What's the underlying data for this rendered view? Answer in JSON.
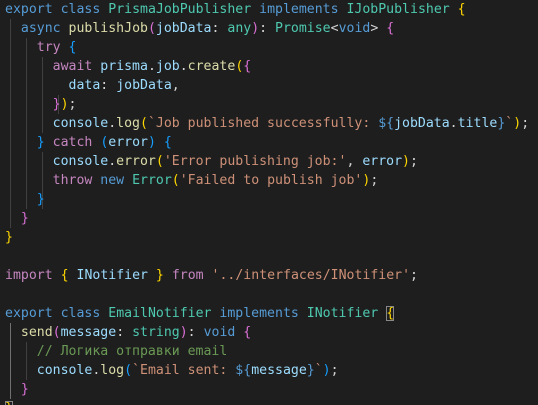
{
  "editor": {
    "theme": {
      "background": "#1e1e1e",
      "keyword": "#569cd6",
      "control": "#c586c0",
      "type": "#4ec9b0",
      "function": "#dcdcaa",
      "variable": "#9cdcfe",
      "string": "#ce9178",
      "comment": "#6a9955",
      "bracket_1": "#ffd700",
      "bracket_2": "#da70d6",
      "bracket_3": "#179fff"
    },
    "lines": [
      [
        {
          "c": "k",
          "t": "export"
        },
        {
          "c": "p",
          "t": " "
        },
        {
          "c": "k",
          "t": "class"
        },
        {
          "c": "p",
          "t": " "
        },
        {
          "c": "ty",
          "t": "PrismaJobPublisher"
        },
        {
          "c": "p",
          "t": " "
        },
        {
          "c": "k",
          "t": "implements"
        },
        {
          "c": "p",
          "t": " "
        },
        {
          "c": "ty",
          "t": "IJobPublisher"
        },
        {
          "c": "p",
          "t": " "
        },
        {
          "c": "b1",
          "t": "{"
        }
      ],
      [
        {
          "c": "p",
          "t": "  "
        },
        {
          "c": "k",
          "t": "async"
        },
        {
          "c": "p",
          "t": " "
        },
        {
          "c": "fn",
          "t": "publishJob"
        },
        {
          "c": "b2",
          "t": "("
        },
        {
          "c": "vr",
          "t": "jobData"
        },
        {
          "c": "p",
          "t": ": "
        },
        {
          "c": "ty",
          "t": "any"
        },
        {
          "c": "b2",
          "t": ")"
        },
        {
          "c": "p",
          "t": ": "
        },
        {
          "c": "ty",
          "t": "Promise"
        },
        {
          "c": "p",
          "t": "<"
        },
        {
          "c": "k",
          "t": "void"
        },
        {
          "c": "p",
          "t": "> "
        },
        {
          "c": "b2",
          "t": "{"
        }
      ],
      [
        {
          "c": "p",
          "t": "    "
        },
        {
          "c": "ctl",
          "t": "try"
        },
        {
          "c": "p",
          "t": " "
        },
        {
          "c": "b3",
          "t": "{"
        }
      ],
      [
        {
          "c": "p",
          "t": "      "
        },
        {
          "c": "ctl",
          "t": "await"
        },
        {
          "c": "p",
          "t": " "
        },
        {
          "c": "vr",
          "t": "prisma"
        },
        {
          "c": "p",
          "t": "."
        },
        {
          "c": "vr",
          "t": "job"
        },
        {
          "c": "p",
          "t": "."
        },
        {
          "c": "fn",
          "t": "create"
        },
        {
          "c": "b1",
          "t": "("
        },
        {
          "c": "b2",
          "t": "{"
        }
      ],
      [
        {
          "c": "p",
          "t": "        "
        },
        {
          "c": "vr",
          "t": "data"
        },
        {
          "c": "p",
          "t": ": "
        },
        {
          "c": "vr",
          "t": "jobData"
        },
        {
          "c": "p",
          "t": ","
        }
      ],
      [
        {
          "c": "p",
          "t": "      "
        },
        {
          "c": "b2",
          "t": "}"
        },
        {
          "c": "b1",
          "t": ")"
        },
        {
          "c": "p",
          "t": ";"
        }
      ],
      [
        {
          "c": "p",
          "t": "      "
        },
        {
          "c": "vr",
          "t": "console"
        },
        {
          "c": "p",
          "t": "."
        },
        {
          "c": "fn",
          "t": "log"
        },
        {
          "c": "b1",
          "t": "("
        },
        {
          "c": "st",
          "t": "`Job published successfully: "
        },
        {
          "c": "k",
          "t": "${"
        },
        {
          "c": "vr",
          "t": "jobData"
        },
        {
          "c": "p",
          "t": "."
        },
        {
          "c": "vr",
          "t": "title"
        },
        {
          "c": "k",
          "t": "}"
        },
        {
          "c": "st",
          "t": "`"
        },
        {
          "c": "b1",
          "t": ")"
        },
        {
          "c": "p",
          "t": ";"
        }
      ],
      [
        {
          "c": "p",
          "t": "    "
        },
        {
          "c": "b3",
          "t": "}"
        },
        {
          "c": "p",
          "t": " "
        },
        {
          "c": "ctl",
          "t": "catch"
        },
        {
          "c": "p",
          "t": " "
        },
        {
          "c": "b3",
          "t": "("
        },
        {
          "c": "vr",
          "t": "error"
        },
        {
          "c": "b3",
          "t": ")"
        },
        {
          "c": "p",
          "t": " "
        },
        {
          "c": "b3",
          "t": "{"
        }
      ],
      [
        {
          "c": "p",
          "t": "      "
        },
        {
          "c": "vr",
          "t": "console"
        },
        {
          "c": "p",
          "t": "."
        },
        {
          "c": "fn",
          "t": "error"
        },
        {
          "c": "b1",
          "t": "("
        },
        {
          "c": "st",
          "t": "'Error publishing job:'"
        },
        {
          "c": "p",
          "t": ", "
        },
        {
          "c": "vr",
          "t": "error"
        },
        {
          "c": "b1",
          "t": ")"
        },
        {
          "c": "p",
          "t": ";"
        }
      ],
      [
        {
          "c": "p",
          "t": "      "
        },
        {
          "c": "ctl",
          "t": "throw"
        },
        {
          "c": "p",
          "t": " "
        },
        {
          "c": "k",
          "t": "new"
        },
        {
          "c": "p",
          "t": " "
        },
        {
          "c": "ty",
          "t": "Error"
        },
        {
          "c": "b1",
          "t": "("
        },
        {
          "c": "st",
          "t": "'Failed to publish job'"
        },
        {
          "c": "b1",
          "t": ")"
        },
        {
          "c": "p",
          "t": ";"
        }
      ],
      [
        {
          "c": "p",
          "t": "    "
        },
        {
          "c": "b3",
          "t": "}"
        }
      ],
      [
        {
          "c": "p",
          "t": "  "
        },
        {
          "c": "b2",
          "t": "}"
        }
      ],
      [
        {
          "c": "b1",
          "t": "}"
        }
      ],
      [],
      [
        {
          "c": "ctl",
          "t": "import"
        },
        {
          "c": "p",
          "t": " "
        },
        {
          "c": "b1",
          "t": "{"
        },
        {
          "c": "p",
          "t": " "
        },
        {
          "c": "vr",
          "t": "INotifier"
        },
        {
          "c": "p",
          "t": " "
        },
        {
          "c": "b1",
          "t": "}"
        },
        {
          "c": "p",
          "t": " "
        },
        {
          "c": "ctl",
          "t": "from"
        },
        {
          "c": "p",
          "t": " "
        },
        {
          "c": "st",
          "t": "'../interfaces/INotifier'"
        },
        {
          "c": "p",
          "t": ";"
        }
      ],
      [],
      [
        {
          "c": "k",
          "t": "export"
        },
        {
          "c": "p",
          "t": " "
        },
        {
          "c": "k",
          "t": "class"
        },
        {
          "c": "p",
          "t": " "
        },
        {
          "c": "ty",
          "t": "EmailNotifier"
        },
        {
          "c": "p",
          "t": " "
        },
        {
          "c": "k",
          "t": "implements"
        },
        {
          "c": "p",
          "t": " "
        },
        {
          "c": "ty",
          "t": "INotifier"
        },
        {
          "c": "p",
          "t": " "
        },
        {
          "c": "b1",
          "t": "{",
          "box": true
        }
      ],
      [
        {
          "c": "p",
          "t": "  "
        },
        {
          "c": "fn",
          "t": "send"
        },
        {
          "c": "b2",
          "t": "("
        },
        {
          "c": "vr",
          "t": "message"
        },
        {
          "c": "p",
          "t": ": "
        },
        {
          "c": "ty",
          "t": "string"
        },
        {
          "c": "b2",
          "t": ")"
        },
        {
          "c": "p",
          "t": ": "
        },
        {
          "c": "k",
          "t": "void"
        },
        {
          "c": "p",
          "t": " "
        },
        {
          "c": "b2",
          "t": "{"
        }
      ],
      [
        {
          "c": "p",
          "t": "    "
        },
        {
          "c": "cm",
          "t": "// Логика отправки email"
        }
      ],
      [
        {
          "c": "p",
          "t": "    "
        },
        {
          "c": "vr",
          "t": "console"
        },
        {
          "c": "p",
          "t": "."
        },
        {
          "c": "fn",
          "t": "log"
        },
        {
          "c": "b3",
          "t": "("
        },
        {
          "c": "st",
          "t": "`Email sent: "
        },
        {
          "c": "k",
          "t": "${"
        },
        {
          "c": "vr",
          "t": "message"
        },
        {
          "c": "k",
          "t": "}"
        },
        {
          "c": "st",
          "t": "`"
        },
        {
          "c": "b3",
          "t": ")"
        },
        {
          "c": "p",
          "t": ";"
        }
      ],
      [
        {
          "c": "p",
          "t": "  "
        },
        {
          "c": "b2",
          "t": "}"
        }
      ],
      [
        {
          "c": "b1",
          "t": "}",
          "box": true
        }
      ]
    ]
  }
}
